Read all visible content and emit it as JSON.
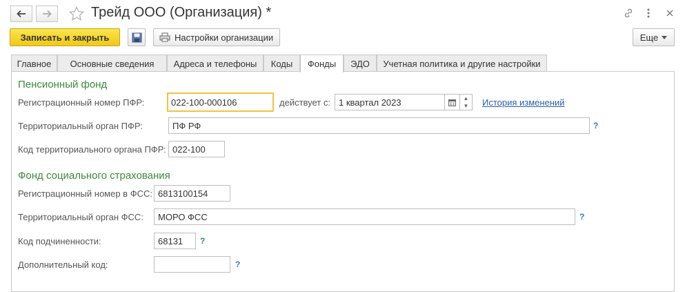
{
  "window": {
    "title": "Трейд ООО (Организация) *",
    "back_icon": "arrow-left-icon",
    "forward_icon": "arrow-right-icon",
    "favorite_icon": "star-icon",
    "link_icon": "link-icon",
    "more_icon": "more-vertical-icon",
    "close_icon": "close-icon"
  },
  "toolbar": {
    "save_close_label": "Записать и закрыть",
    "save_icon": "floppy-disk-icon",
    "settings_icon": "printer-icon",
    "settings_label": "Настройки организации",
    "more_label": "Еще",
    "accent_color": "#f5d228"
  },
  "tabs": [
    {
      "label": "Главное"
    },
    {
      "label": "Основные сведения"
    },
    {
      "label": "Адреса и телефоны"
    },
    {
      "label": "Коды"
    },
    {
      "label": "Фонды",
      "active": true
    },
    {
      "label": "ЭДО"
    },
    {
      "label": "Учетная политика и другие настройки"
    }
  ],
  "pfr": {
    "section_title": "Пенсионный фонд",
    "reg_number_label": "Регистрационный номер ПФР:",
    "reg_number_value": "022-100-000106",
    "valid_from_label": "действует с:",
    "valid_from_value": "1 квартал 2023",
    "history_link": "История изменений",
    "territorial_label": "Территориальный орган ПФР:",
    "territorial_value": "ПФ РФ",
    "territorial_code_label": "Код территориального органа ПФР:",
    "territorial_code_value": "022-100",
    "help": "?"
  },
  "fss": {
    "section_title": "Фонд социального страхования",
    "reg_number_label": "Регистрационный номер в ФСС:",
    "reg_number_value": "6813100154",
    "territorial_label": "Территориальный орган ФСС:",
    "territorial_value": "МОРО ФСС",
    "subordination_label": "Код подчиненности:",
    "subordination_value": "68131",
    "additional_code_label": "Дополнительный код:",
    "additional_code_value": "",
    "help": "?"
  },
  "colors": {
    "section_title": "#3a8c3a",
    "help": "#2e7bb6",
    "link": "#2a5db0",
    "focus_border": "#f0c43a"
  }
}
